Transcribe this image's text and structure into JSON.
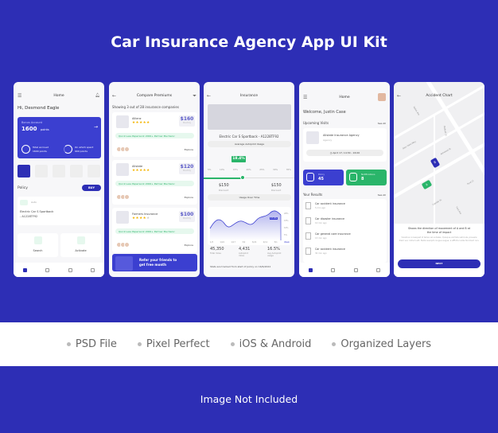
{
  "title": "Car Insurance Agency App UI Kit",
  "features": [
    "PSD File",
    "Pixel Perfect",
    "iOS & Android",
    "Organized Layers"
  ],
  "note": "Image Not Included",
  "colors": {
    "brand": "#2d2eb5",
    "green": "#2ab56a",
    "star": "#f4b400"
  },
  "screen1": {
    "header": "Home",
    "greeting": "Hi, Desmond Eagle",
    "bonus_label": "Bonus Account",
    "bonus_points": "1600",
    "points_unit": "points",
    "accrued_label": "Total accrued",
    "accrued_value": "1600 points",
    "spent_label": "On which spent",
    "spent_value": "900 points",
    "policy_label": "Policy",
    "buy": "BUY",
    "policy_type": "Auto",
    "policy_car": "Electric Car S Sportback",
    "policy_id": "- A1228TF92",
    "search": "Search",
    "activate": "Activate"
  },
  "screen2": {
    "header": "Compare Premiums",
    "showing": "Showing 3 out of 28 insurance companies",
    "tags": "Quick   Less Paperwork   2000+ Partner Mechanic",
    "explore": "Explore",
    "period": "Monthly",
    "companies": [
      {
        "name": "Allianz",
        "price": "$160",
        "rating": 5
      },
      {
        "name": "Allstate",
        "price": "$120",
        "rating": 5
      },
      {
        "name": "Farmers Insurance",
        "price": "$100",
        "rating": 4
      }
    ],
    "refer": "Refer your friends to get free month"
  },
  "screen3": {
    "header": "Insurance",
    "car": "Electric Car S Sportback - A1228TF92",
    "avg_btn": "Average Autopilot Usage",
    "bubble": "18.4%",
    "ticks": [
      "5%",
      "10%",
      "15%",
      "20%",
      "25%",
      "30%",
      "35%"
    ],
    "left_price": "$150",
    "left_label": "Discount",
    "right_price": "$150",
    "right_label": "Discount",
    "usage_btn": "Usage Over Time",
    "chart_y": [
      "20%",
      "15%",
      "10%",
      "5%"
    ],
    "chart_x": [
      "1/3",
      "1/24",
      "1/17",
      "3/2",
      "3/24",
      "4/11",
      "5/1",
      "Week"
    ],
    "chart_badge": "17.4%",
    "stats": [
      {
        "value": "45,350",
        "label": "Total miles"
      },
      {
        "value": "4,431",
        "label": "Autopilot miles"
      },
      {
        "value": "16.5%",
        "label": "Avg Autopilot usage"
      }
    ],
    "footer": "Stats are tracked from start of policy on 16/6/2022"
  },
  "screen4": {
    "header": "Home",
    "welcome": "Welcome, Justin Case",
    "visits": "Upcoming Visits",
    "see_all": "See All",
    "agency": "Allstate Insurance Agency",
    "agency_sub": "Agency",
    "time": "April 17, 14:30 - 16:00",
    "policy_label": "Policy",
    "policy_count": "45",
    "notif_label": "Notifications",
    "notif_count": "8",
    "results": "Your Results",
    "items": [
      {
        "title": "Car accident insurance",
        "time": "5 min ago"
      },
      {
        "title": "Car disaster insurance",
        "time": "10 min ago"
      },
      {
        "title": "Car general care insurance",
        "time": "15 min ago"
      },
      {
        "title": "Car accident insurance",
        "time": "30 min ago"
      }
    ]
  },
  "screen5": {
    "header": "Accident Chart",
    "streets": [
      "Noble Ave",
      "Glen Oaks Way",
      "Ashwood St",
      "Mallard Ct",
      "Cabrillo St",
      "Ford Ct",
      "Ford Ave"
    ],
    "car_a": "A",
    "car_b": "B",
    "desc_title": "Shows the direction of movement of A and B at the time of impact",
    "desc_body": "Vivamus consequat id tellus vel sodales. Quisque vel felis vehicula, posuere diam vel, rutrum elit. Nulla suscipit congue augue, a efficitur ante tincidunt non.",
    "next": "NEXT"
  }
}
